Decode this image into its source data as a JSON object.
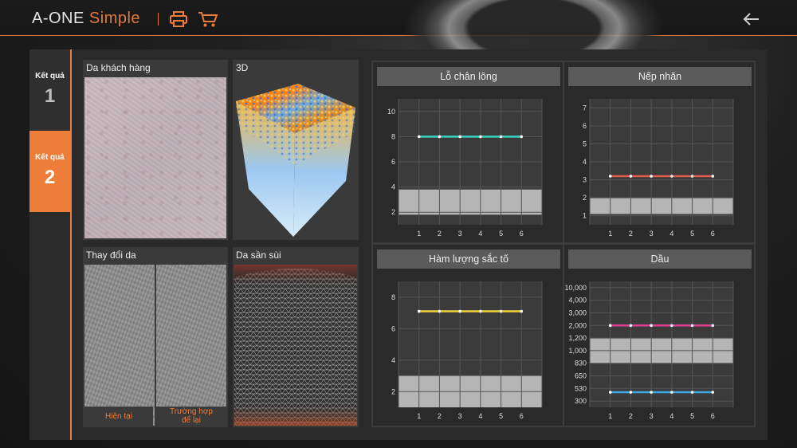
{
  "header": {
    "logo_main": "A-ONE ",
    "logo_accent": "Simple",
    "icons": {
      "print": "printer-icon",
      "cart": "cart-icon",
      "back": "back-arrow-icon"
    }
  },
  "tabs": [
    {
      "label": "Kết quả",
      "number": "1",
      "active": false
    },
    {
      "label": "Kết quả",
      "number": "2",
      "active": true
    }
  ],
  "cards": {
    "customer_skin": "Da khách hàng",
    "three_d": "3D",
    "skin_change": "Thay đổi da",
    "rough_skin": "Da sần sùi",
    "current_label": "Hiện tại",
    "case_label": "Trường hợp để lại"
  },
  "colors": {
    "accent": "#ef7d3a",
    "pore": "#39d3c3",
    "wrinkle": "#e25a4a",
    "pigment": "#f2cf3b",
    "oil_high": "#e0408f",
    "oil_low": "#3ba8e8"
  },
  "chart_data": [
    {
      "type": "line",
      "title": "Lỗ chân lông",
      "categories": [
        "1",
        "2",
        "3",
        "4",
        "5",
        "6"
      ],
      "y_ticks": [
        "10",
        "8",
        "6",
        "4",
        "2"
      ],
      "ylim": [
        1,
        11
      ],
      "band": [
        1.8,
        3.8
      ],
      "series": [
        {
          "values": [
            8,
            8,
            8,
            8,
            8,
            8
          ],
          "color": "#39d3c3"
        }
      ]
    },
    {
      "type": "line",
      "title": "Nếp nhăn",
      "categories": [
        "1",
        "2",
        "3",
        "4",
        "5",
        "6"
      ],
      "y_ticks": [
        "7",
        "6",
        "5",
        "4",
        "3",
        "2",
        "1"
      ],
      "ylim": [
        0.5,
        7.5
      ],
      "band": [
        1.1,
        2.0
      ],
      "series": [
        {
          "values": [
            3.2,
            3.2,
            3.2,
            3.2,
            3.2,
            3.2
          ],
          "color": "#e25a4a"
        }
      ]
    },
    {
      "type": "line",
      "title": "Hàm lượng sắc tố",
      "categories": [
        "1",
        "2",
        "3",
        "4",
        "5",
        "6"
      ],
      "y_ticks": [
        "8",
        "6",
        "4",
        "2"
      ],
      "ylim": [
        1,
        9
      ],
      "band": [
        1,
        3
      ],
      "series": [
        {
          "values": [
            7.1,
            7.1,
            7.1,
            7.1,
            7.1,
            7.1
          ],
          "color": "#f2cf3b"
        }
      ]
    },
    {
      "type": "line",
      "title": "Dầu",
      "categories": [
        "1",
        "2",
        "3",
        "4",
        "5",
        "6"
      ],
      "y_ticks": [
        "10,000",
        "4,000",
        "3,000",
        "2,000",
        "1,200",
        "1,000",
        "830",
        "650",
        "530",
        "300"
      ],
      "ylim": [
        0,
        10
      ],
      "scale": "categorical-ticks",
      "band": [
        3.5,
        5.5
      ],
      "series": [
        {
          "values": [
            6.5,
            6.5,
            6.5,
            6.5,
            6.5,
            6.5
          ],
          "color": "#e0408f"
        },
        {
          "values": [
            1.2,
            1.2,
            1.2,
            1.2,
            1.2,
            1.2
          ],
          "color": "#3ba8e8"
        }
      ]
    }
  ]
}
